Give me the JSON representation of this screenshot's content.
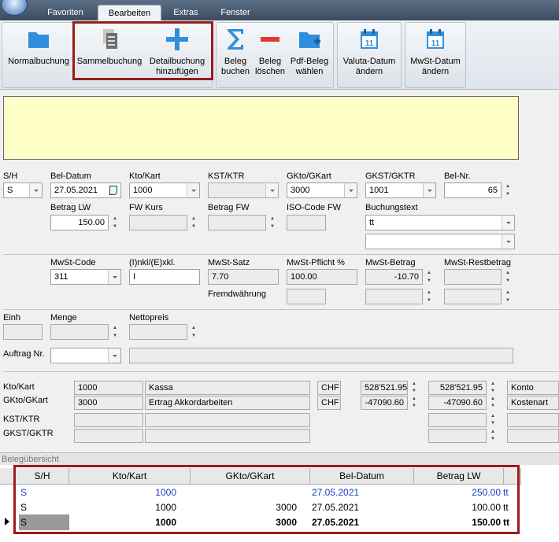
{
  "tabs": [
    {
      "label": "Favoriten"
    },
    {
      "label": "Bearbeiten"
    },
    {
      "label": "Extras"
    },
    {
      "label": "Fenster"
    }
  ],
  "ribbon": {
    "normal": "Normalbuchung",
    "sammel": "Sammelbuchung",
    "detail": "Detailbuchung\nhinzufügen",
    "beleg_buchen": "Beleg\nbuchen",
    "beleg_loeschen": "Beleg\nlöschen",
    "pdf_beleg": "Pdf-Beleg\nwählen",
    "valuta": "Valuta-Datum\nändern",
    "mwst_datum": "MwSt-Datum\nändern",
    "calendar_day": "11"
  },
  "form": {
    "sh": {
      "label": "S/H",
      "value": "S"
    },
    "bel_datum": {
      "label": "Bel-Datum",
      "value": "27.05.2021"
    },
    "kto": {
      "label": "Kto/Kart",
      "value": "1000"
    },
    "kst": {
      "label": "KST/KTR",
      "value": ""
    },
    "gkto": {
      "label": "GKto/GKart",
      "value": "3000"
    },
    "gkst": {
      "label": "GKST/GKTR",
      "value": "1001"
    },
    "bel_nr": {
      "label": "Bel-Nr.",
      "value": "65"
    },
    "betrag_lw": {
      "label": "Betrag LW",
      "value": "150.00"
    },
    "fw_kurs": {
      "label": "FW Kurs",
      "value": ""
    },
    "betrag_fw": {
      "label": "Betrag FW",
      "value": ""
    },
    "iso_fw": {
      "label": "ISO-Code FW",
      "value": ""
    },
    "buchungstext": {
      "label": "Buchungstext",
      "value": "tt",
      "value2": ""
    },
    "mwst_code": {
      "label": "MwSt-Code",
      "value": "311"
    },
    "inkl": {
      "label": "(I)nkl/(E)xkl.",
      "value": "I"
    },
    "mwst_satz": {
      "label": "MwSt-Satz",
      "value": "7.70"
    },
    "mwst_pflicht": {
      "label": "MwSt-Pflicht %",
      "value": "100.00"
    },
    "mwst_betrag": {
      "label": "MwSt-Betrag",
      "value": "-10.70"
    },
    "mwst_rest": {
      "label": "MwSt-Restbetrag",
      "value": ""
    },
    "fremdwaehrung": {
      "label": "Fremdwährung",
      "value": ""
    },
    "einh": {
      "label": "Einh",
      "value": ""
    },
    "menge": {
      "label": "Menge",
      "value": ""
    },
    "nettopreis": {
      "label": "Nettopreis",
      "value": ""
    },
    "auftrag": {
      "label": "Auftrag Nr.",
      "value": ""
    }
  },
  "info": {
    "labels": {
      "kto": "Kto/Kart",
      "gkto": "GKto/GKart",
      "kst": "KST/KTR",
      "gkst": "GKST/GKTR"
    },
    "kto": {
      "nr": "1000",
      "name": "Kassa",
      "cur": "CHF",
      "saldo": "528'521.95",
      "saldo2": "528'521.95",
      "type": "Konto"
    },
    "gkto": {
      "nr": "3000",
      "name": "Ertrag Akkordarbeiten",
      "cur": "CHF",
      "saldo": "-47090.60",
      "saldo2": "-47090.60",
      "type": "Kostenart"
    }
  },
  "grid": {
    "title": "Belegübersicht",
    "columns": [
      "S/H",
      "Kto/Kart",
      "GKto/GKart",
      "Bel-Datum",
      "Betrag LW"
    ],
    "rows": [
      {
        "sh": "S",
        "kto": "1000",
        "gkto": "",
        "datum": "27.05.2021",
        "betrag": "250.00",
        "text": "tt"
      },
      {
        "sh": "S",
        "kto": "1000",
        "gkto": "3000",
        "datum": "27.05.2021",
        "betrag": "100.00",
        "text": "tt"
      },
      {
        "sh": "S",
        "kto": "1000",
        "gkto": "3000",
        "datum": "27.05.2021",
        "betrag": "150.00",
        "text": "tt"
      }
    ]
  },
  "colors": {
    "highlight": "#9b1b1b",
    "notes_bg": "#ffffc8",
    "row_blue": "#1a3fc4",
    "icon_blue": "#2f8fdc",
    "icon_red": "#e0392b"
  }
}
